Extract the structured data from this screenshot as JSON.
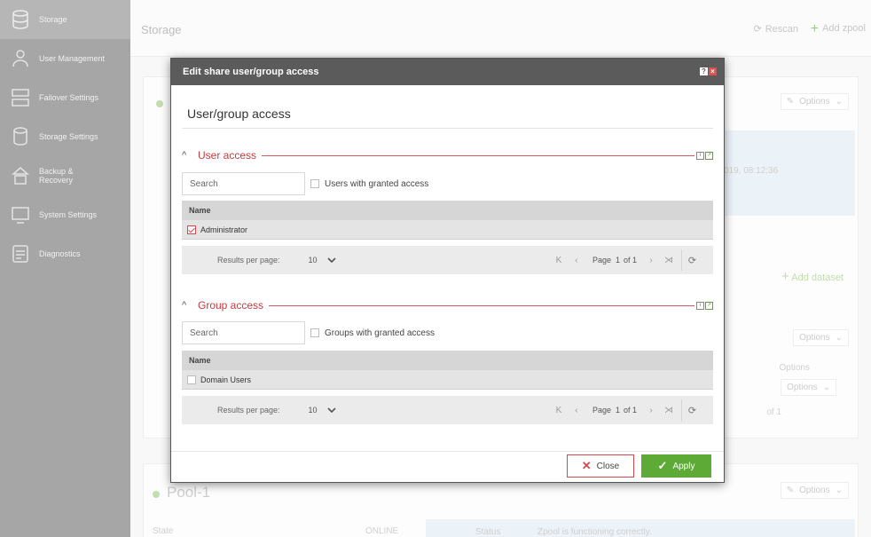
{
  "sidebar": {
    "items": [
      {
        "label": "Storage",
        "icon": "database-icon",
        "active": true
      },
      {
        "label": "User Management",
        "icon": "users-icon"
      },
      {
        "label": "Failover Settings",
        "icon": "failover-icon"
      },
      {
        "label": "Storage Settings",
        "icon": "storage-settings-icon"
      },
      {
        "label": "Backup & Recovery",
        "icon": "backup-icon"
      },
      {
        "label": "System Settings",
        "icon": "system-settings-icon"
      },
      {
        "label": "Diagnostics",
        "icon": "diagnostics-icon"
      }
    ]
  },
  "header": {
    "title": "Storage",
    "rescan_label": "Rescan",
    "add_zpool_label": "Add zpool"
  },
  "background": {
    "options_label": "Options",
    "add_dataset_label": "Add dataset",
    "timestamp_fragment": "019, 08:12:36",
    "pool_name": "Pool-1",
    "pool_state_label": "State",
    "pool_state_value": "ONLINE",
    "pool_status_label": "Status",
    "pool_status_value": "Zpool is functioning correctly.",
    "pager_fragment": "of 1",
    "options_col_label": "Options"
  },
  "dialog": {
    "header_title": "Edit share user/group access",
    "title": "User/group access",
    "user_section": {
      "title": "User access",
      "search_placeholder": "Search",
      "granted_label": "Users with granted access",
      "column_name": "Name",
      "rows": [
        {
          "name": "Administrator",
          "checked": true
        }
      ],
      "results_per_page_label": "Results per page:",
      "results_per_page_value": "10",
      "page_label": "Page",
      "page_num": "1",
      "page_of": "of 1"
    },
    "group_section": {
      "title": "Group access",
      "search_placeholder": "Search",
      "granted_label": "Groups with granted access",
      "column_name": "Name",
      "rows": [
        {
          "name": "Domain Users",
          "checked": false
        }
      ],
      "results_per_page_label": "Results per page:",
      "results_per_page_value": "10",
      "page_label": "Page",
      "page_num": "1",
      "page_of": "of 1"
    },
    "close_label": "Close",
    "apply_label": "Apply"
  },
  "colors": {
    "accent_red": "#c9393e",
    "apply_green": "#5eaa37",
    "sidebar": "#5d5d5d"
  }
}
